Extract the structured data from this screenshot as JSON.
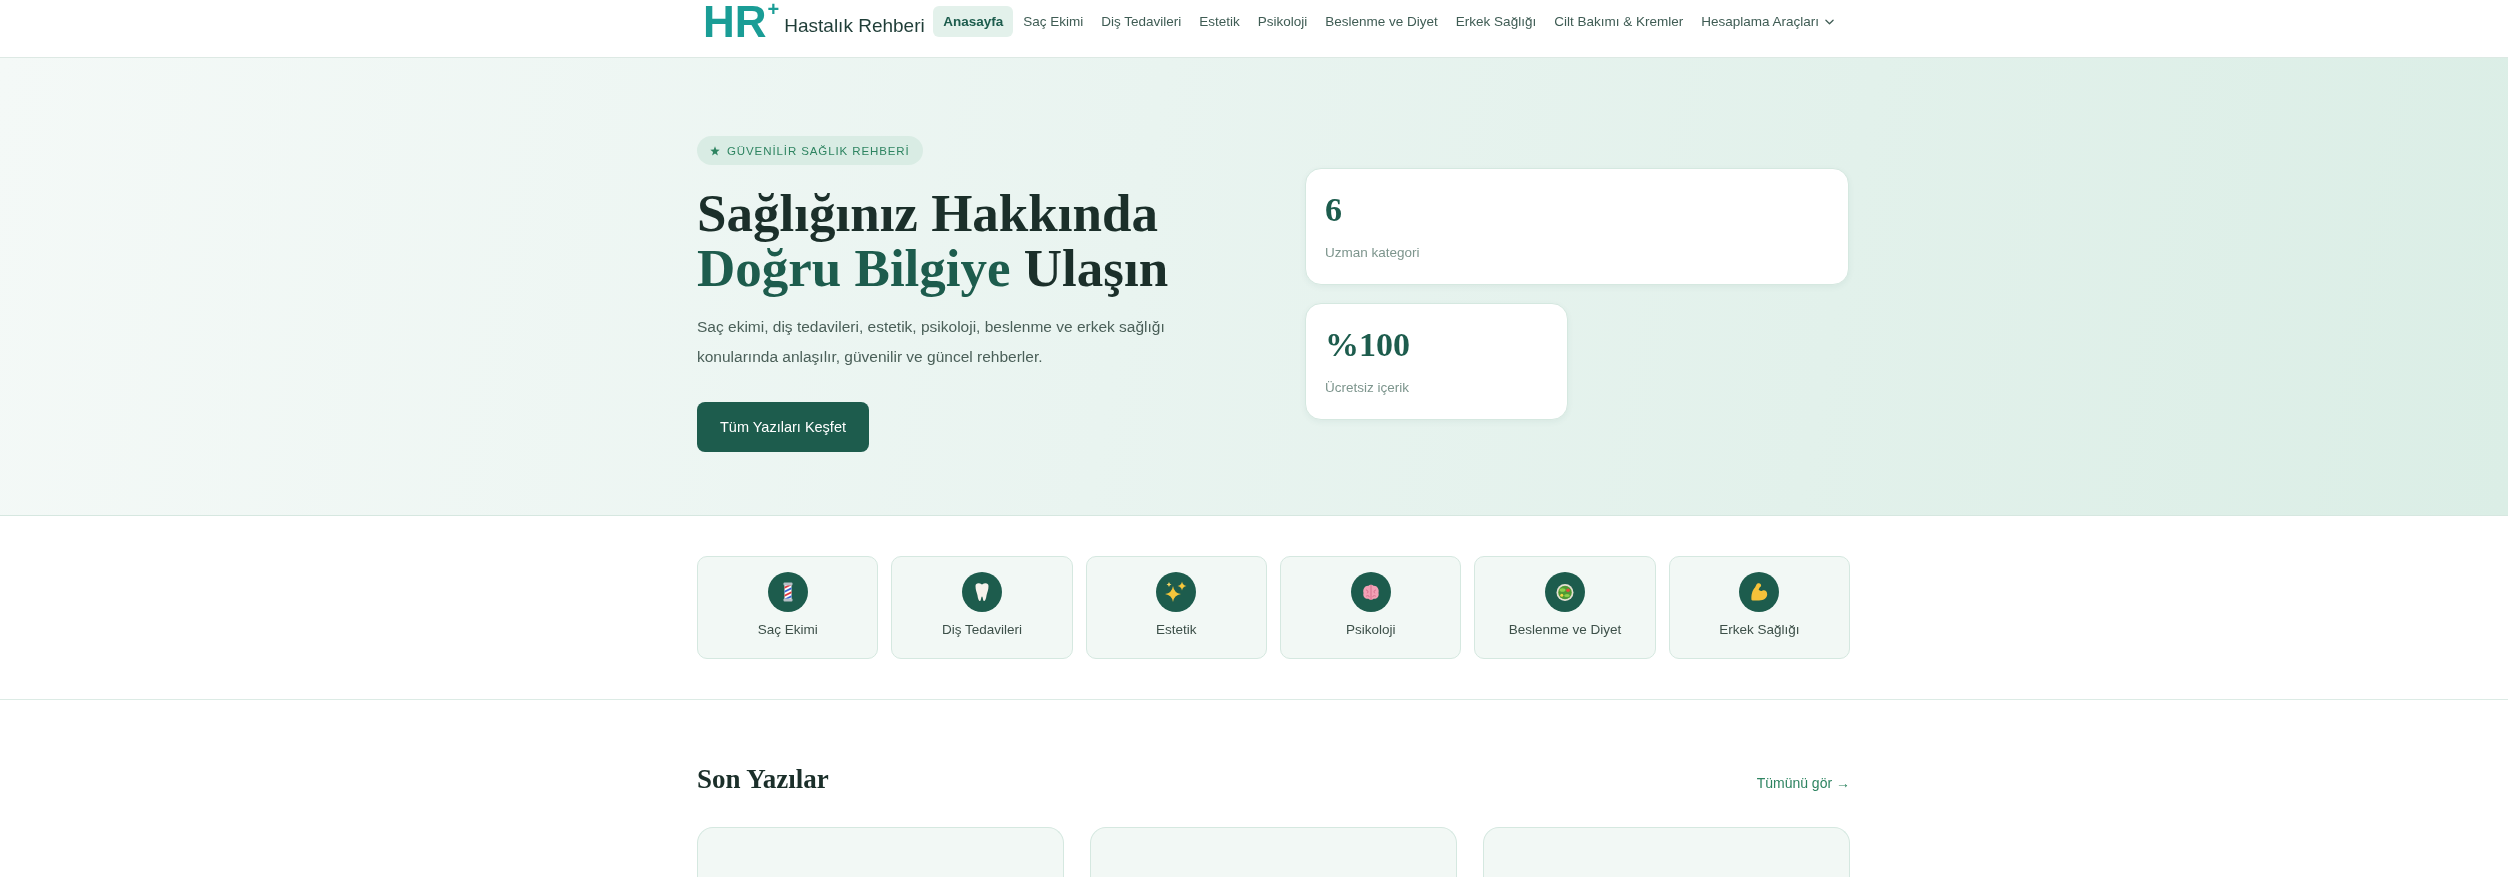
{
  "header": {
    "logo": {
      "mark": "HR$^{+}$",
      "name": "Hastalık Rehberi"
    },
    "nav": [
      {
        "label": "Anasayfa",
        "selected": true,
        "kind": "link"
      },
      {
        "label": "Saç Ekimi",
        "selected": false,
        "kind": "link"
      },
      {
        "label": "Diş Tedavileri",
        "selected": false,
        "kind": "link"
      },
      {
        "label": "Estetik",
        "selected": false,
        "kind": "link"
      },
      {
        "label": "Psikoloji",
        "selected": false,
        "kind": "link"
      },
      {
        "label": "Beslenme ve Diyet",
        "selected": false,
        "kind": "link"
      },
      {
        "label": "Erkek Sağlığı",
        "selected": false,
        "kind": "link"
      },
      {
        "label": "Cilt Bakımı & Kremler",
        "selected": false,
        "kind": "link"
      },
      {
        "label": "Hesaplama Araçları",
        "selected": false,
        "kind": "dropdown"
      }
    ]
  },
  "hero": {
    "badge": "GÜVENİLİR SAĞLIK REHBERİ",
    "title": {
      "text": "Sağlığınız Hakkında",
      "highlight": "Doğru Bilgiye",
      "text_end": "Ulaşın"
    },
    "description": "Saç ekimi, diş tedavileri, estetik, psikoloji, beslenme ve erkek sağlığı konularında anlaşılır, güvenilir ve güncel rehberler.",
    "button": "Tüm Yazıları Keşfet",
    "stats": [
      {
        "value": "6",
        "label": "Uzman kategori"
      },
      {
        "value": "%100",
        "label": "Ücretsiz içerik"
      }
    ]
  },
  "categories": [
    {
      "label": "Saç Ekimi"
    },
    {
      "label": "Diş Tedavileri"
    },
    {
      "label": "Estetik"
    },
    {
      "label": "Psikoloji"
    },
    {
      "label": "Beslenme ve Diyet"
    },
    {
      "label": "Erkek Sağlığı"
    }
  ],
  "recent_posts": {
    "title": "Son Yazılar",
    "link": "Tümünü gör →"
  }
}
